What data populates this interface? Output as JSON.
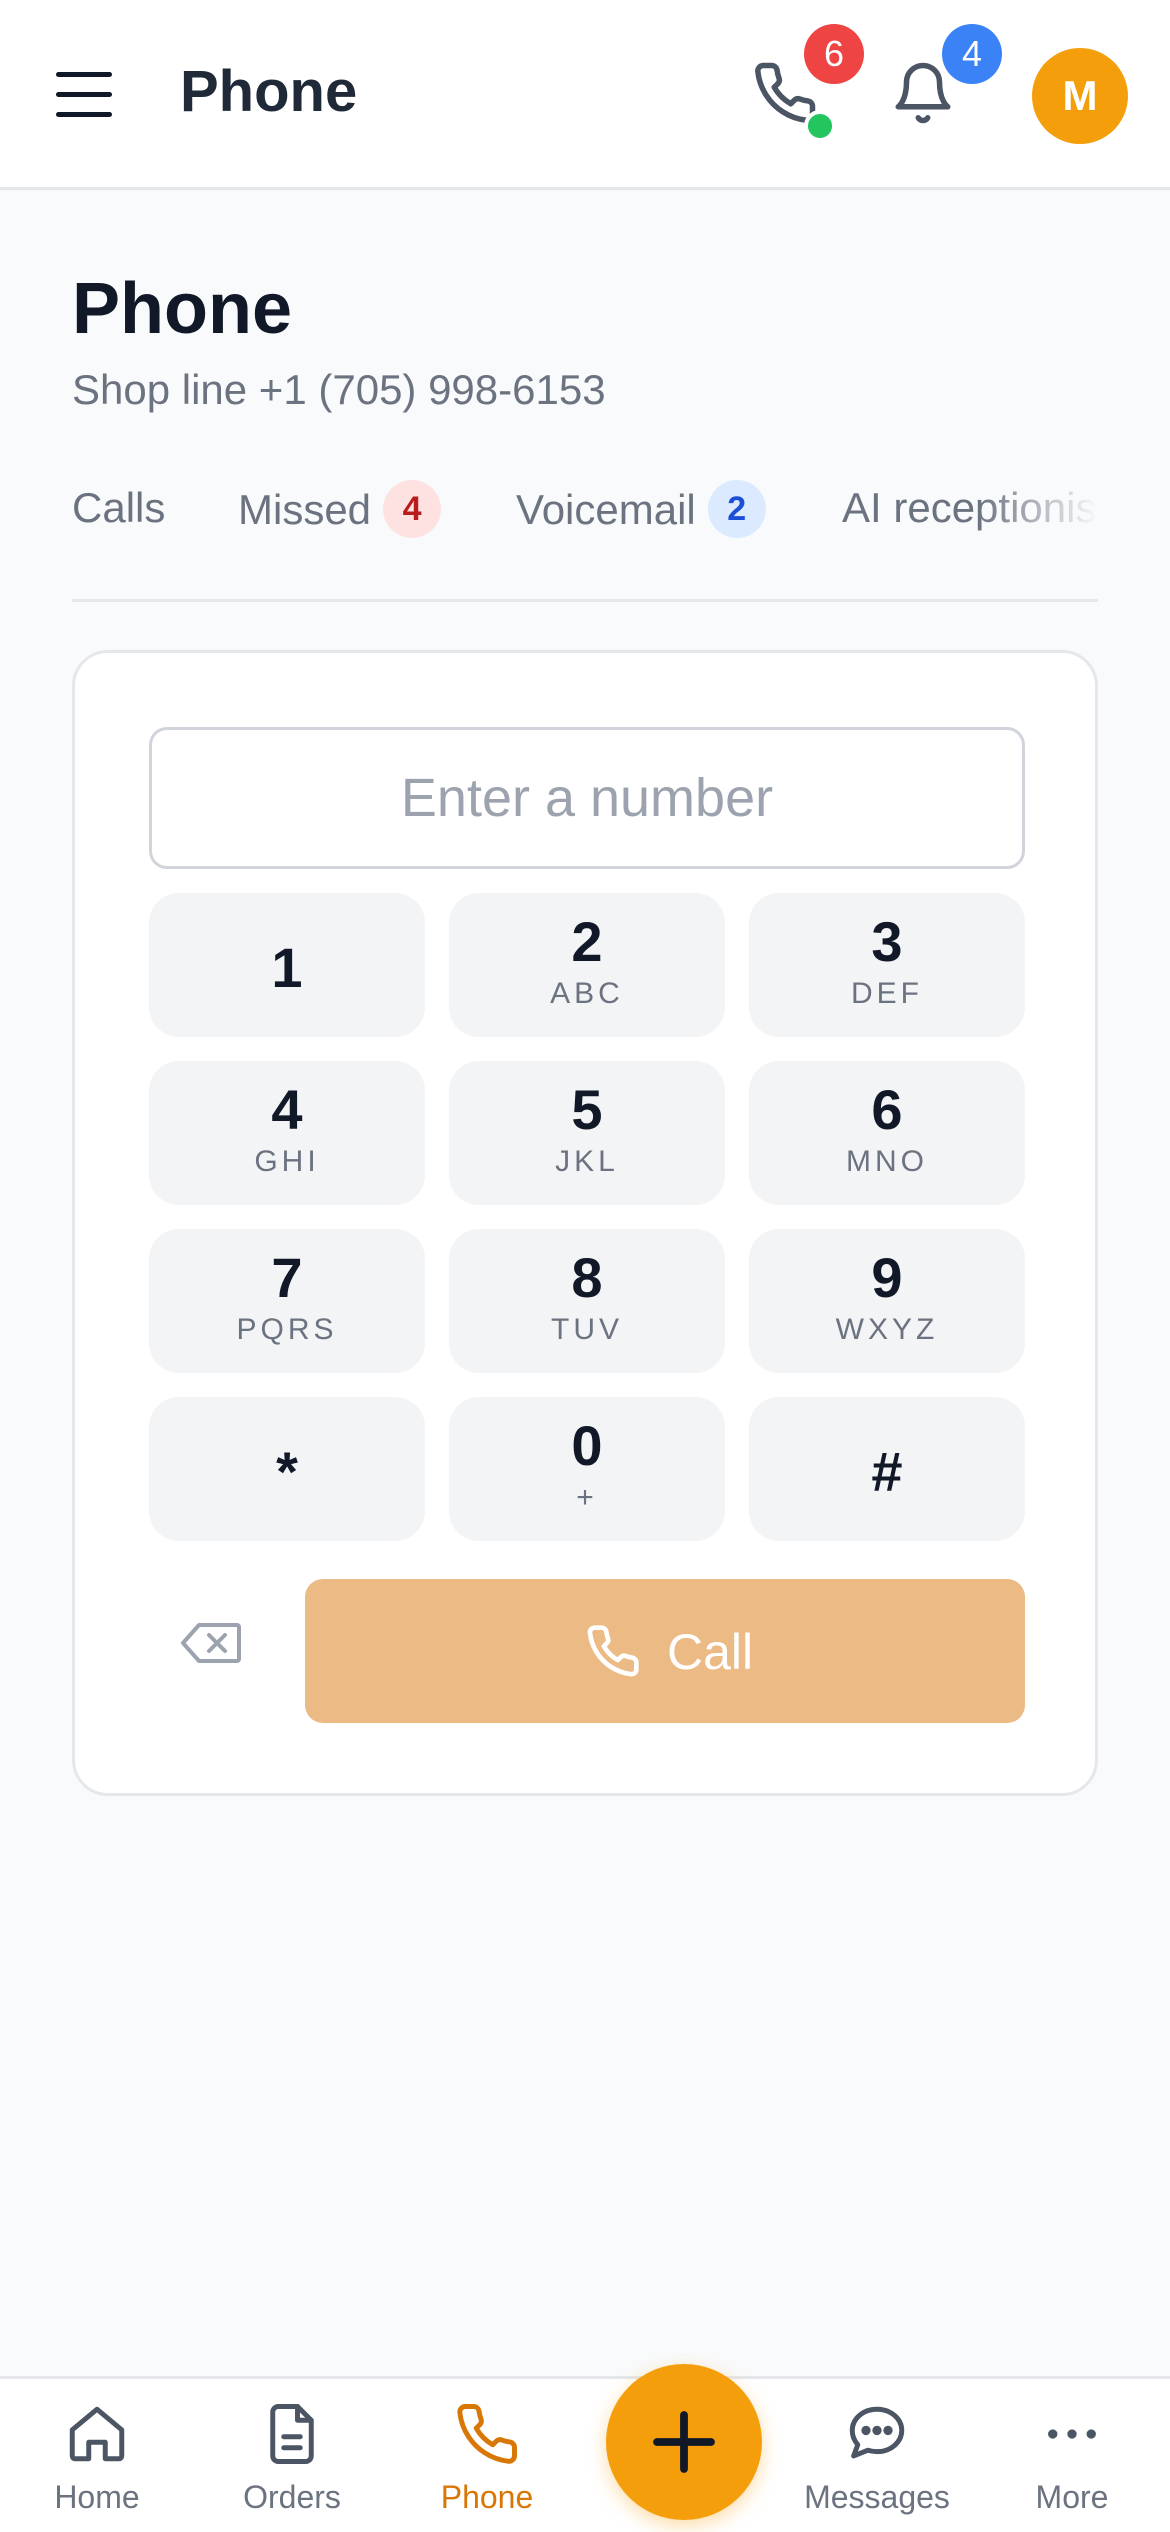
{
  "header": {
    "title": "Phone",
    "calls_badge": "6",
    "notifications_badge": "4",
    "avatar_initial": "M"
  },
  "page": {
    "title": "Phone",
    "subtitle": "Shop line +1 (705) 998-6153"
  },
  "tabs": [
    {
      "label": "Calls",
      "count": ""
    },
    {
      "label": "Missed",
      "count": "4"
    },
    {
      "label": "Voicemail",
      "count": "2"
    },
    {
      "label": "AI receptionist",
      "count": ""
    }
  ],
  "dialer": {
    "placeholder": "Enter a number",
    "value": "",
    "keys": [
      {
        "digit": "1",
        "letters": ""
      },
      {
        "digit": "2",
        "letters": "ABC"
      },
      {
        "digit": "3",
        "letters": "DEF"
      },
      {
        "digit": "4",
        "letters": "GHI"
      },
      {
        "digit": "5",
        "letters": "JKL"
      },
      {
        "digit": "6",
        "letters": "MNO"
      },
      {
        "digit": "7",
        "letters": "PQRS"
      },
      {
        "digit": "8",
        "letters": "TUV"
      },
      {
        "digit": "9",
        "letters": "WXYZ"
      },
      {
        "digit": "*",
        "letters": ""
      },
      {
        "digit": "0",
        "letters": "+"
      },
      {
        "digit": "#",
        "letters": ""
      }
    ],
    "call_label": "Call"
  },
  "bottom_nav": [
    {
      "label": "Home",
      "icon": "home-icon"
    },
    {
      "label": "Orders",
      "icon": "document-icon"
    },
    {
      "label": "Phone",
      "icon": "phone-icon",
      "active": true
    },
    {
      "label": "Messages",
      "icon": "chat-icon"
    },
    {
      "label": "More",
      "icon": "more-icon"
    }
  ],
  "colors": {
    "accent": "#f59e0b",
    "accent_text": "#d97706",
    "call_button": "#ecba84",
    "danger_badge": "#ef4444",
    "info_badge": "#3b82f6",
    "online": "#22c55e"
  }
}
